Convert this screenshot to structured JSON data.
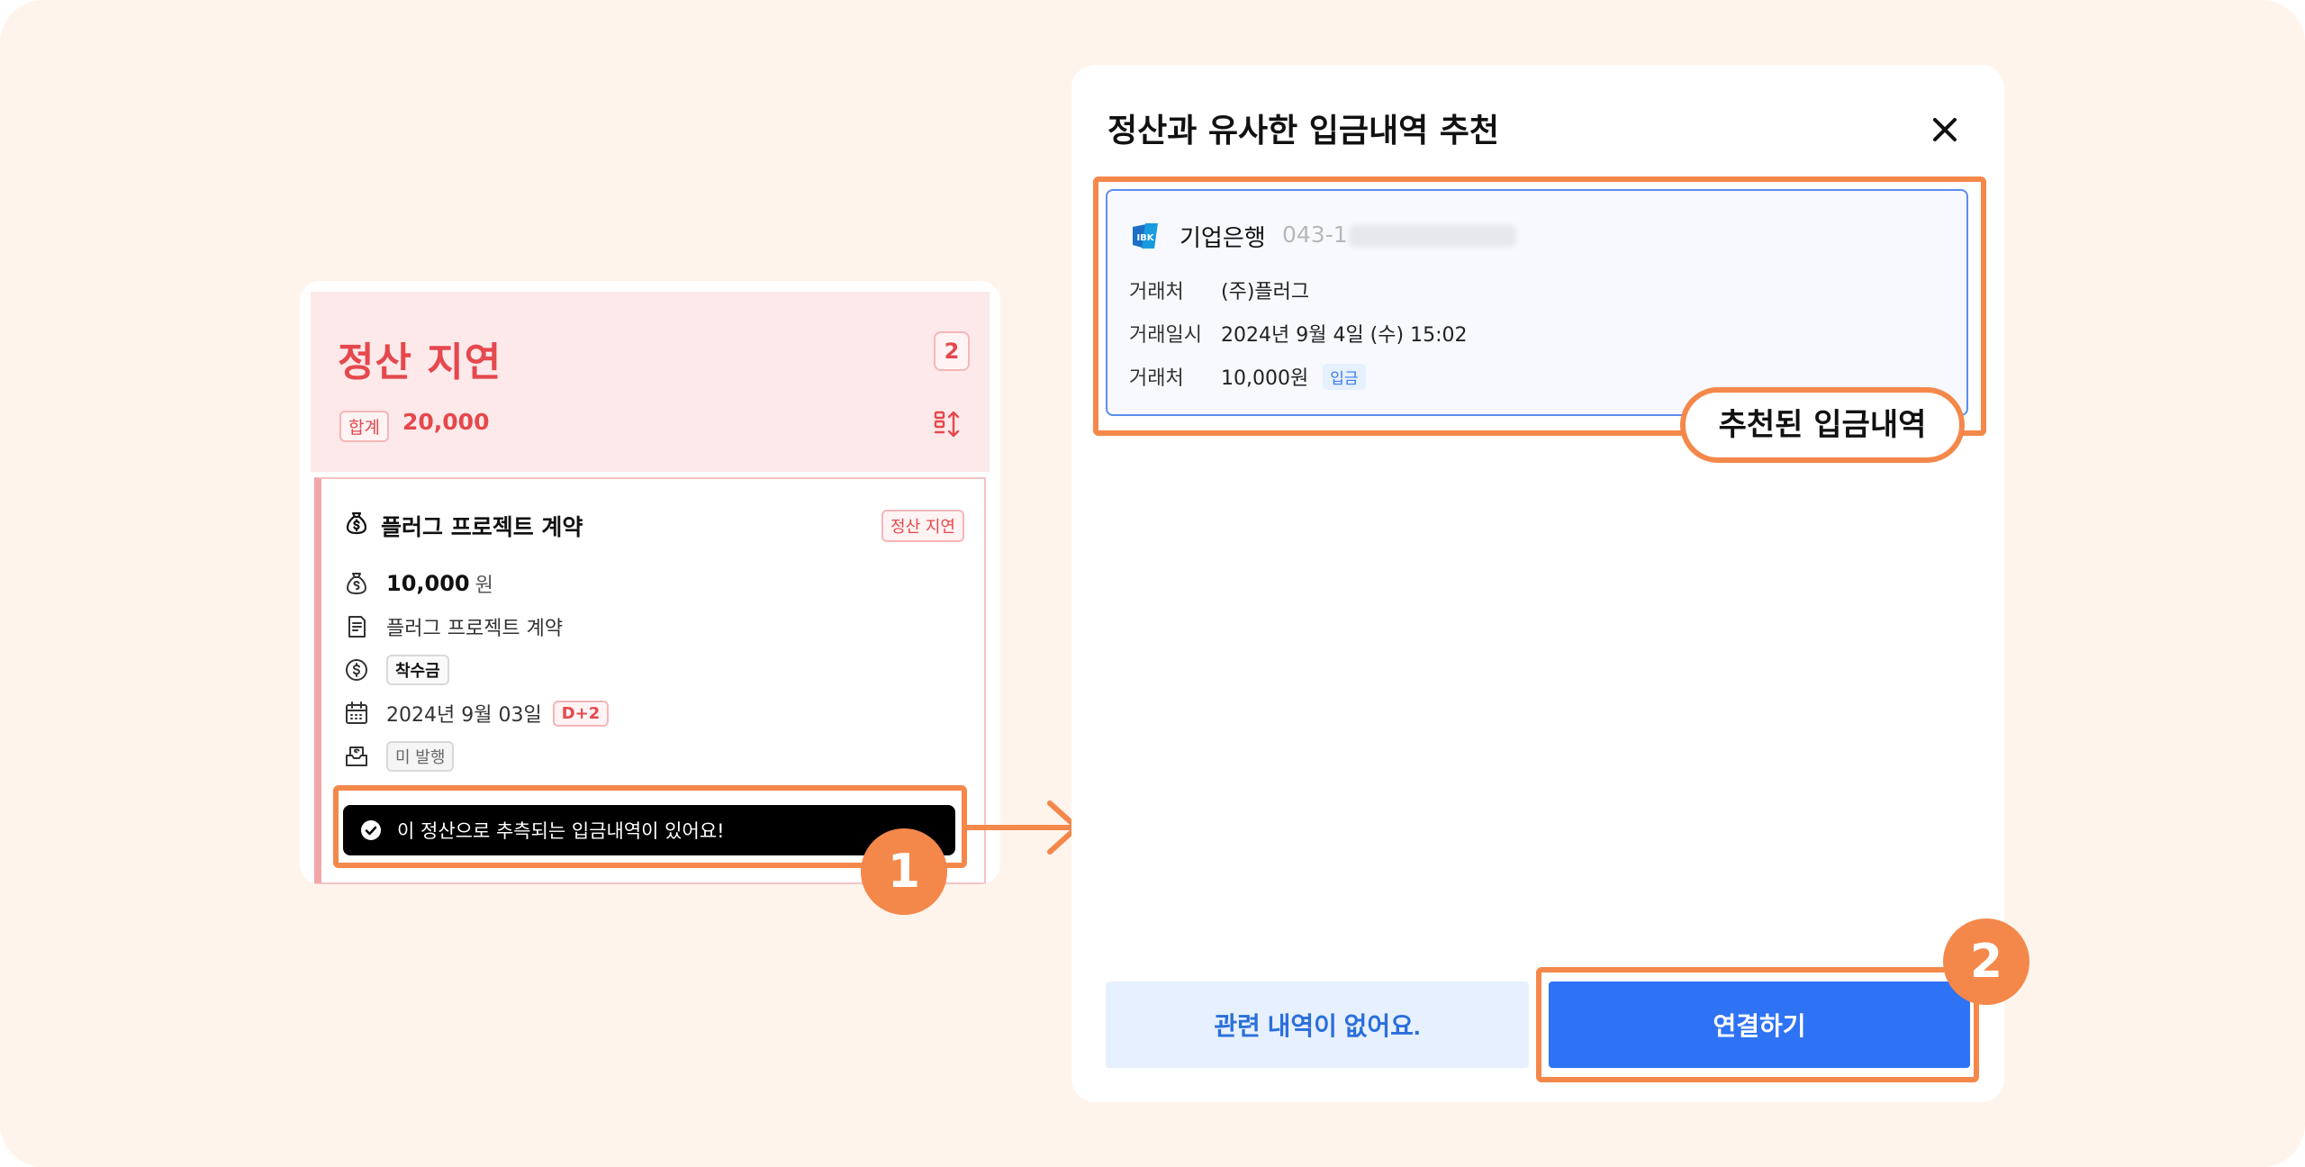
{
  "left_card": {
    "header": {
      "title": "정산 지연",
      "count": "2",
      "sum_label": "합계",
      "sum_value": "20,000"
    },
    "item": {
      "title": "플러그 프로젝트 계약",
      "status_badge": "정산 지연",
      "amount": "10,000",
      "amount_unit": "원",
      "contract": "플러그 프로젝트 계약",
      "payment_type": "착수금",
      "date": "2024년 9월 03일",
      "d_day": "D+2",
      "invoice_status": "미 발행"
    },
    "toast": "이 정산으로 추측되는 입금내역이 있어요!"
  },
  "modal": {
    "title": "정산과 유사한 입금내역 추천",
    "account": {
      "bank_name": "기업은행",
      "account_prefix": "043-1",
      "rows": [
        {
          "key": "거래처",
          "value": "(주)플러그"
        },
        {
          "key": "거래일시",
          "value": "2024년 9월 4일 (수) 15:02"
        },
        {
          "key": "거래처",
          "value": "10,000원",
          "chip": "입금"
        }
      ]
    },
    "recommended_tag": "추천된 입금내역",
    "buttons": {
      "none_label": "관련 내역이 없어요.",
      "link_label": "연결하기"
    }
  },
  "callouts": {
    "step1": "1",
    "step2": "2"
  },
  "colors": {
    "accent_orange": "#f4884a",
    "danger_red": "#e5484d",
    "primary_blue": "#2f73f5"
  }
}
